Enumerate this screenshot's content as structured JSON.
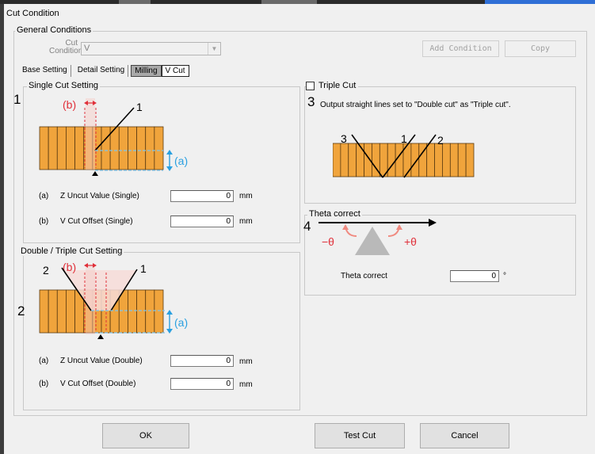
{
  "window": {
    "title": "Cut Condition"
  },
  "general": {
    "group_label": "General Conditions",
    "cut_condition_label_1": "Cut",
    "cut_condition_label_2": "Condition",
    "cut_condition_value": "V",
    "add_condition_label": "Add Condition",
    "copy_label": "Copy"
  },
  "tabs": [
    {
      "label": "Base Setting"
    },
    {
      "label": "Detail Setting"
    },
    {
      "label": "Milling"
    },
    {
      "label": "V Cut"
    }
  ],
  "single": {
    "group_label": "Single Cut Setting",
    "marker": "1",
    "diagram_b": "(b)",
    "diagram_a": "(a)",
    "diagram_line": "1",
    "z_uncut_key": "(a)",
    "z_uncut_label": "Z Uncut Value (Single)",
    "z_uncut_value": "0",
    "offset_key": "(b)",
    "offset_label": "V Cut Offset (Single)",
    "offset_value": "0",
    "unit": "mm"
  },
  "double": {
    "group_label": "Double / Triple Cut Setting",
    "marker": "2",
    "diagram_b": "(b)",
    "diagram_a": "(a)",
    "diagram_line_left": "2",
    "diagram_line_right": "1",
    "z_uncut_key": "(a)",
    "z_uncut_label": "Z Uncut Value (Double)",
    "z_uncut_value": "0",
    "offset_key": "(b)",
    "offset_label": "V Cut Offset (Double)",
    "offset_value": "0",
    "unit": "mm"
  },
  "triple": {
    "checkbox_label": "Triple Cut",
    "marker": "3",
    "description": "Output straight lines set to \"Double cut\" as \"Triple cut\".",
    "line3": "3",
    "line1": "1",
    "line2": "2"
  },
  "theta": {
    "group_label": "Theta correct",
    "marker": "4",
    "minus": "−θ",
    "plus": "+θ",
    "field_label": "Theta correct",
    "value": "0",
    "unit": "°"
  },
  "footer": {
    "ok_label": "OK",
    "test_cut_label": "Test Cut",
    "cancel_label": "Cancel"
  },
  "colors": {
    "bar_fill": "#f0a43c",
    "bar_stroke": "#5a3a10",
    "red": "#e0303a",
    "blue": "#2aa0e0"
  }
}
